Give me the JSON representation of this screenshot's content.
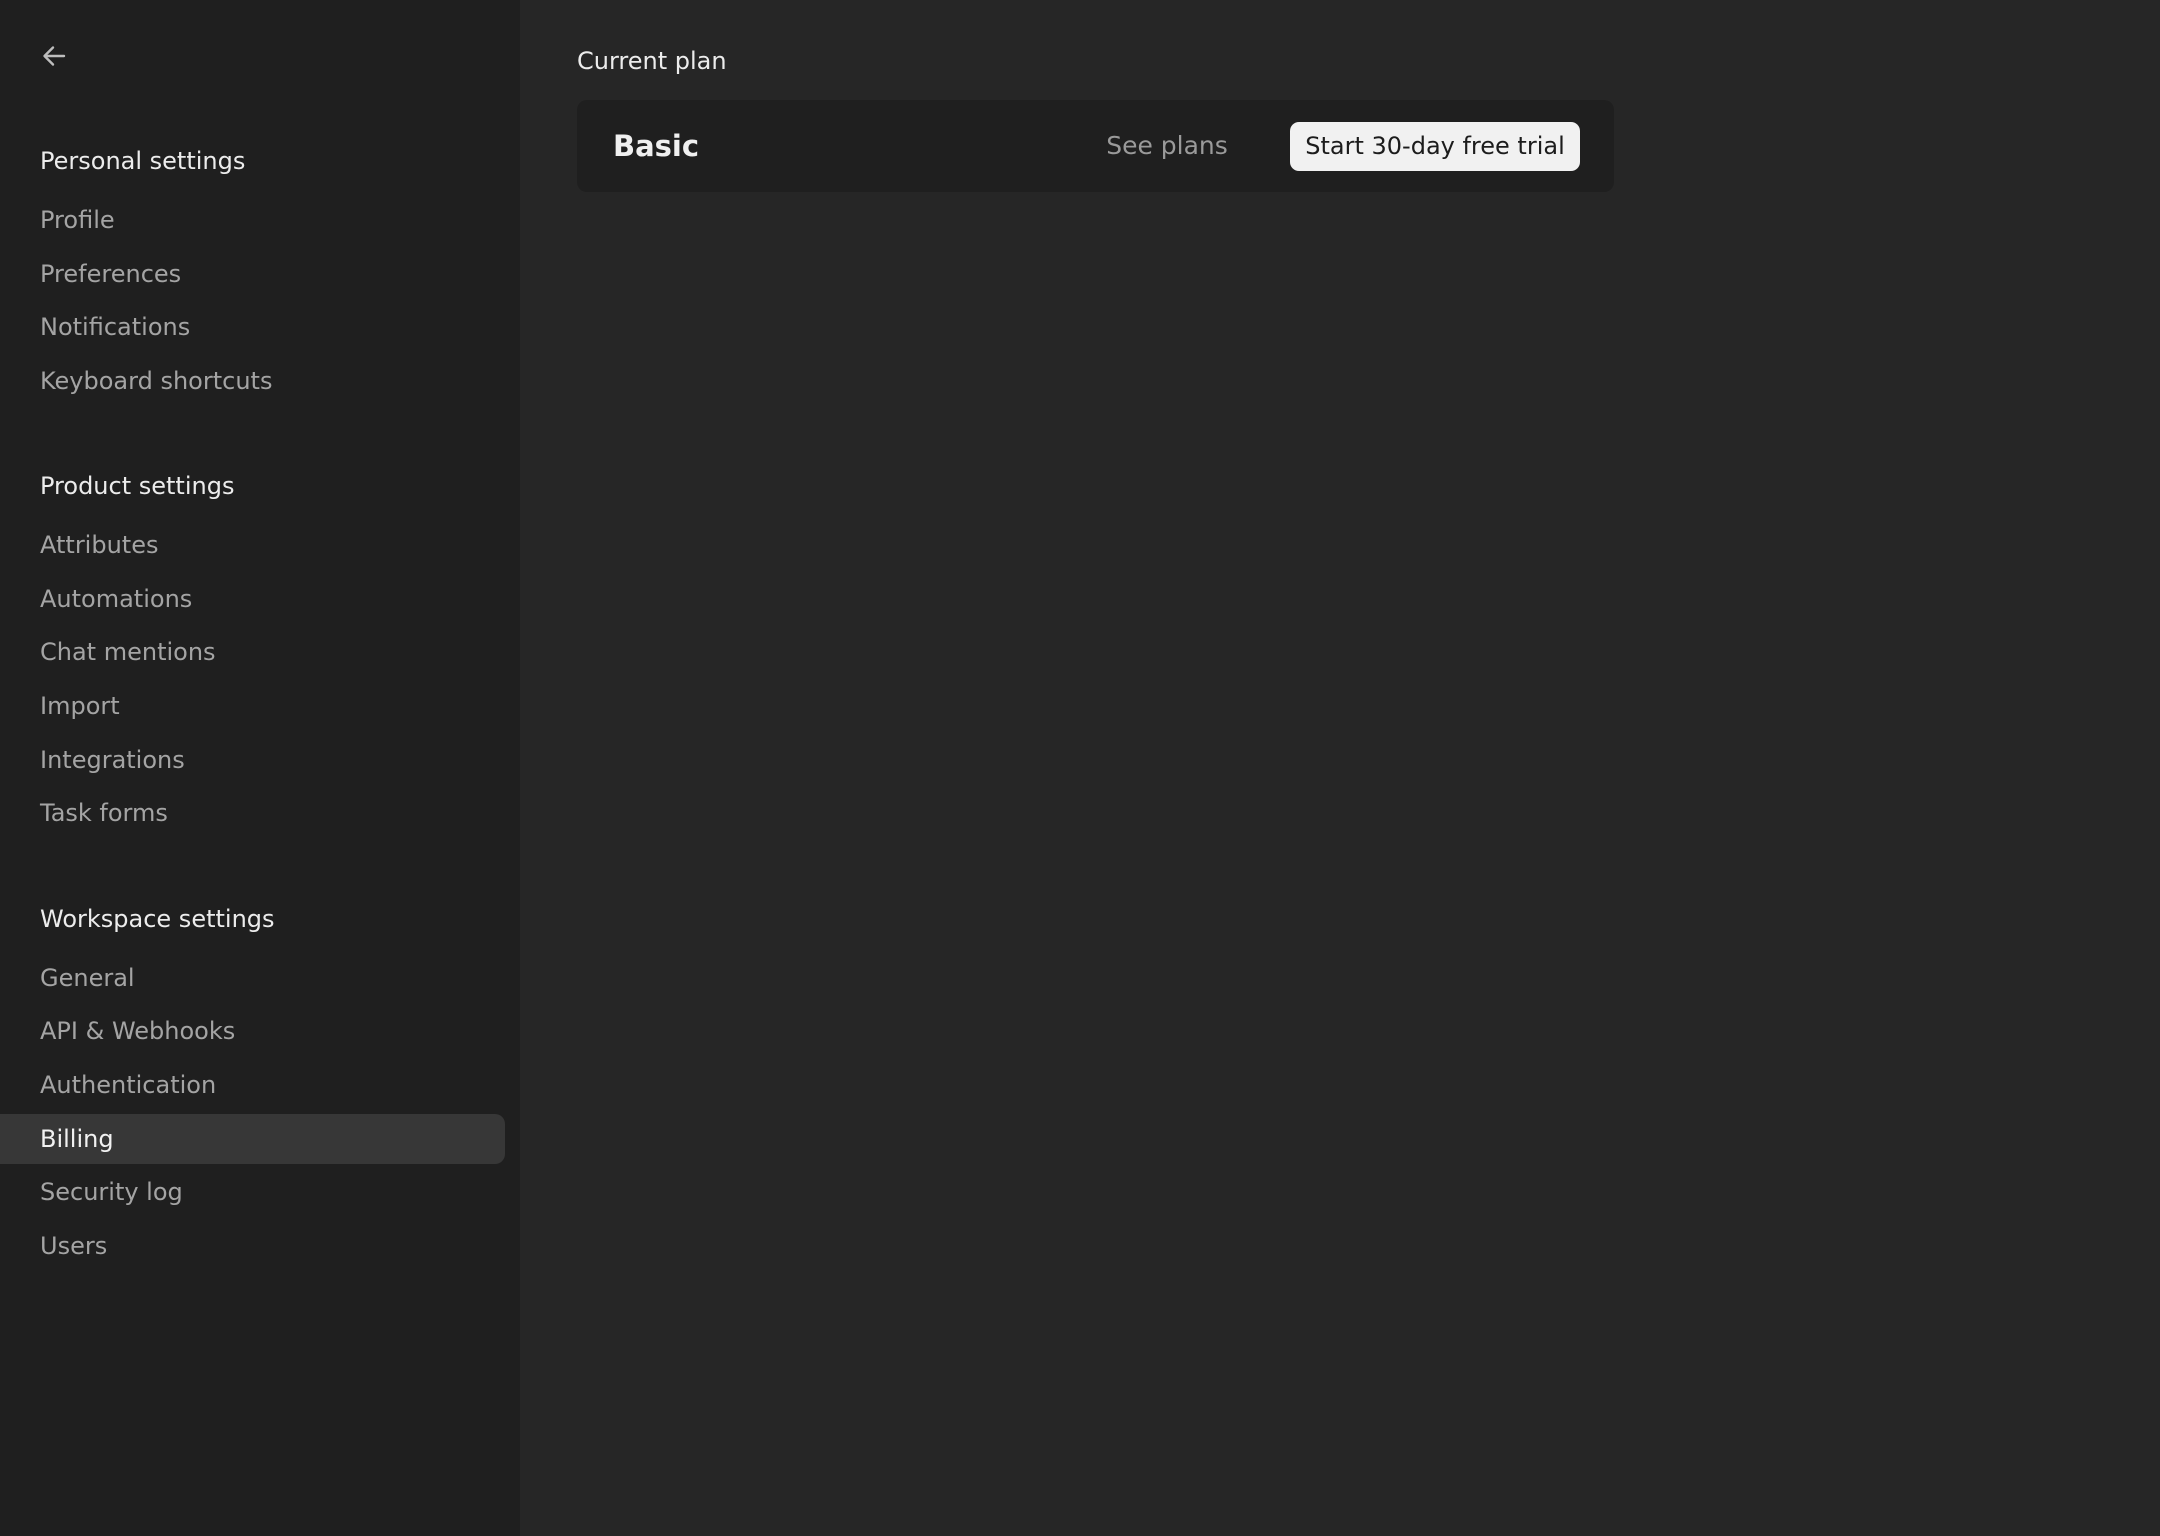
{
  "sidebar": {
    "back_icon": "arrow-left-icon",
    "sections": [
      {
        "heading": "Personal settings",
        "items": [
          {
            "label": "Profile"
          },
          {
            "label": "Preferences"
          },
          {
            "label": "Notifications"
          },
          {
            "label": "Keyboard shortcuts"
          }
        ]
      },
      {
        "heading": "Product settings",
        "items": [
          {
            "label": "Attributes"
          },
          {
            "label": "Automations"
          },
          {
            "label": "Chat mentions"
          },
          {
            "label": "Import"
          },
          {
            "label": "Integrations"
          },
          {
            "label": "Task forms"
          }
        ]
      },
      {
        "heading": "Workspace settings",
        "items": [
          {
            "label": "General"
          },
          {
            "label": "API & Webhooks"
          },
          {
            "label": "Authentication"
          },
          {
            "label": "Billing"
          },
          {
            "label": "Security log"
          },
          {
            "label": "Users"
          }
        ]
      }
    ],
    "active_item": "Billing"
  },
  "main": {
    "title": "Current plan",
    "plan": {
      "name": "Basic",
      "see_plans_label": "See plans",
      "trial_label": "Start 30-day free trial"
    }
  },
  "colors": {
    "background": "#262626",
    "sidebar_background": "#1f1f1f",
    "card_background": "#1f1f1f",
    "active_item_background": "#373737",
    "primary_button_background": "#f1f1f1"
  }
}
